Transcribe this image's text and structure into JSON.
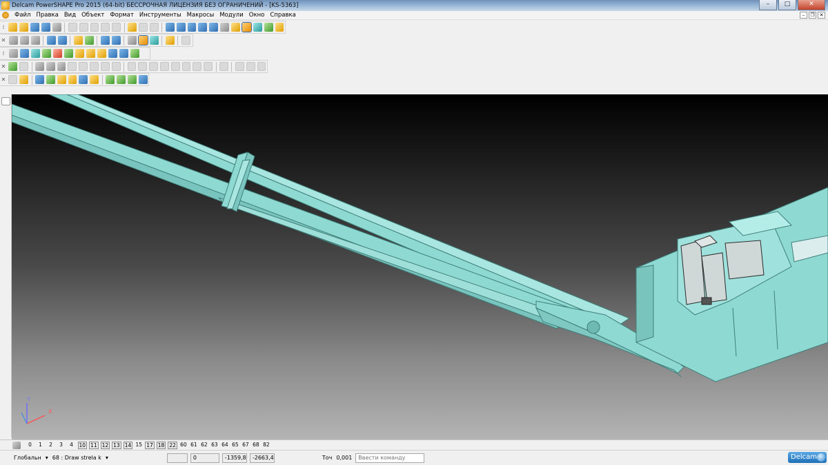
{
  "titlebar": {
    "title": "Delcam PowerSHAPE Pro 2015 (64-bit) БЕССРОЧНАЯ ЛИЦЕНЗИЯ БЕЗ ОГРАНИЧЕНИЙ - [KS-5363]",
    "minimize": "–",
    "maximize": "□",
    "close": "✕"
  },
  "menubar": {
    "items": [
      "Файл",
      "Правка",
      "Вид",
      "Объект",
      "Формат",
      "Инструменты",
      "Макросы",
      "Модули",
      "Окно",
      "Справка"
    ],
    "mdi_minimize": "–",
    "mdi_restore": "❐",
    "mdi_close": "✕"
  },
  "viewport": {
    "axis_x": "X",
    "axis_y": "Y",
    "model_color": "#8fd9d3",
    "model_edge_color": "#3f7f7a"
  },
  "levels": {
    "items": [
      {
        "label": "0",
        "boxed": false
      },
      {
        "label": "1",
        "boxed": false
      },
      {
        "label": "2",
        "boxed": false
      },
      {
        "label": "3",
        "boxed": false
      },
      {
        "label": "4",
        "boxed": false
      },
      {
        "label": "10",
        "boxed": true
      },
      {
        "label": "11",
        "boxed": true
      },
      {
        "label": "12",
        "boxed": true
      },
      {
        "label": "13",
        "boxed": true
      },
      {
        "label": "14",
        "boxed": true
      },
      {
        "label": "15",
        "boxed": false
      },
      {
        "label": "17",
        "boxed": true
      },
      {
        "label": "18",
        "boxed": true
      },
      {
        "label": "22",
        "boxed": true
      },
      {
        "label": "60",
        "boxed": false
      },
      {
        "label": "61",
        "boxed": false
      },
      {
        "label": "62",
        "boxed": false
      },
      {
        "label": "63",
        "boxed": false
      },
      {
        "label": "64",
        "boxed": false
      },
      {
        "label": "65",
        "boxed": false
      },
      {
        "label": "67",
        "boxed": false
      },
      {
        "label": "68",
        "boxed": false
      },
      {
        "label": "82",
        "boxed": false
      }
    ]
  },
  "statusbar": {
    "workplane": "Глобальн",
    "level": "68 : Draw strela k",
    "value_0": "0",
    "coord_x": "-1359,8",
    "coord_y": "-2663,4",
    "tol_label": "Точ",
    "tolerance": "0,001",
    "command_placeholder": "Ввести команду",
    "brand": "Delcam"
  }
}
